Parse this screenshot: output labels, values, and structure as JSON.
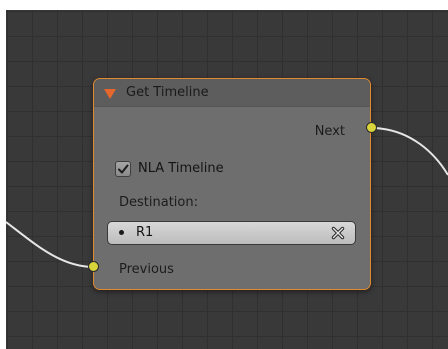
{
  "node": {
    "title": "Get Timeline",
    "output_label": "Next",
    "checkbox_label": "NLA Timeline",
    "checkbox_checked": true,
    "destination_label": "Destination:",
    "destination_value": "R1",
    "input_label": "Previous"
  },
  "icons": {
    "collapse": "triangle-down-icon",
    "check": "checkmark-icon",
    "clear": "x-icon",
    "bullet": "dot-icon"
  },
  "colors": {
    "canvas_bg": "#393939",
    "grid_line": "#303030",
    "node_border": "#e1892d",
    "node_body": "#6e6e6e",
    "node_header": "#5d5d5d",
    "collapse_triangle": "#e5672d",
    "socket": "#d8d43a",
    "wire": "#e6e6e6"
  }
}
